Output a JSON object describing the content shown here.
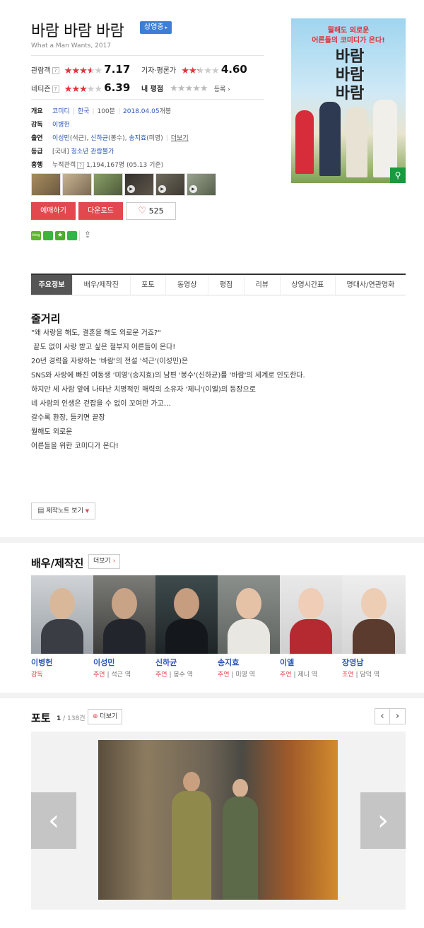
{
  "movie": {
    "title": "바람 바람 바람",
    "status_badge": "상영중",
    "subtitle": "What a Man Wants, 2017"
  },
  "ratings": {
    "audience": {
      "label": "관람객",
      "value": "7.17",
      "fraction": 0.717
    },
    "critics": {
      "label": "기자·평론가",
      "value": "4.60",
      "fraction": 0.46
    },
    "netizen": {
      "label": "네티즌",
      "value": "6.39",
      "fraction": 0.639
    },
    "my_rating": {
      "label": "내 평점",
      "register": "등록"
    }
  },
  "info": {
    "overview_label": "개요",
    "genre": "코미디",
    "country": "한국",
    "runtime": "100분",
    "release": "2018.04.05",
    "release_suffix": "개봉",
    "director_label": "감독",
    "director": "이병헌",
    "cast_label": "출연",
    "cast": [
      {
        "name": "이성민",
        "role": "(석근)"
      },
      {
        "name": "신하균",
        "role": "(봉수)"
      },
      {
        "name": "송지효",
        "role": "(미영)"
      }
    ],
    "more_cast": "더보기",
    "grade_label": "등급",
    "grade_prefix": "[국내]",
    "grade": "청소년 관람불가",
    "box_label": "흥행",
    "box_text": "누적관객",
    "box_value": "1,194,167명",
    "box_date": "(05.13 기준)"
  },
  "buttons": {
    "reserve": "예매하기",
    "download": "다운로드",
    "likes": "525"
  },
  "poster": {
    "tagline1": "뭘해도 외로운",
    "tagline2": "어른들의 코미디가 온다!",
    "logo": "바람\n바람\n바람"
  },
  "tabs": [
    "주요정보",
    "배우/제작진",
    "포토",
    "동영상",
    "평점",
    "리뷰",
    "상영시간표",
    "명대사/연관영화"
  ],
  "synopsis": {
    "title": "줄거리",
    "lines": [
      "\"왜 사랑을 해도, 결혼을 해도 외로운 거죠?\"",
      " 끝도 없이 사랑 받고 싶은 철부지 어른들이 온다!",
      "",
      "20년 경력을 자랑하는 '바람'의 전설 '석근'(이성민)은",
      "SNS와 사랑에 빠진 여동생 '미영'(송지효)의 남편 '봉수'(신하균)를 '바람'의 세계로 인도한다.",
      "",
      "하지만 세 사람 앞에 나타난 치명적인 매력의 소유자 '제니'(이엘)의 등장으로",
      "네 사람의 인생은 걷잡을 수 없이 꼬여만 가고…",
      "",
      "갈수록 환장, 들키면 끝장",
      "뭘해도 외로운",
      "어른들을 위한 코미디가 온다!"
    ],
    "notes_button": "제작노트 보기"
  },
  "cast_section": {
    "title": "배우/제작진",
    "more": "더보기",
    "people": [
      {
        "name": "이병헌",
        "role": "감독",
        "char": ""
      },
      {
        "name": "이성민",
        "role": "주연",
        "char": "석근 역"
      },
      {
        "name": "신하균",
        "role": "주연",
        "char": "봉수 역"
      },
      {
        "name": "송지효",
        "role": "주연",
        "char": "미영 역"
      },
      {
        "name": "이엘",
        "role": "주연",
        "char": "제니 역"
      },
      {
        "name": "장영남",
        "role": "조연",
        "char": "담덕 역"
      }
    ]
  },
  "photo_section": {
    "title": "포토",
    "current": "1",
    "total": "/ 138건",
    "more": "더보기"
  },
  "colors": {
    "accent_red": "#e2484e",
    "link_blue": "#2a56b8",
    "badge_blue": "#3d7ed8"
  }
}
